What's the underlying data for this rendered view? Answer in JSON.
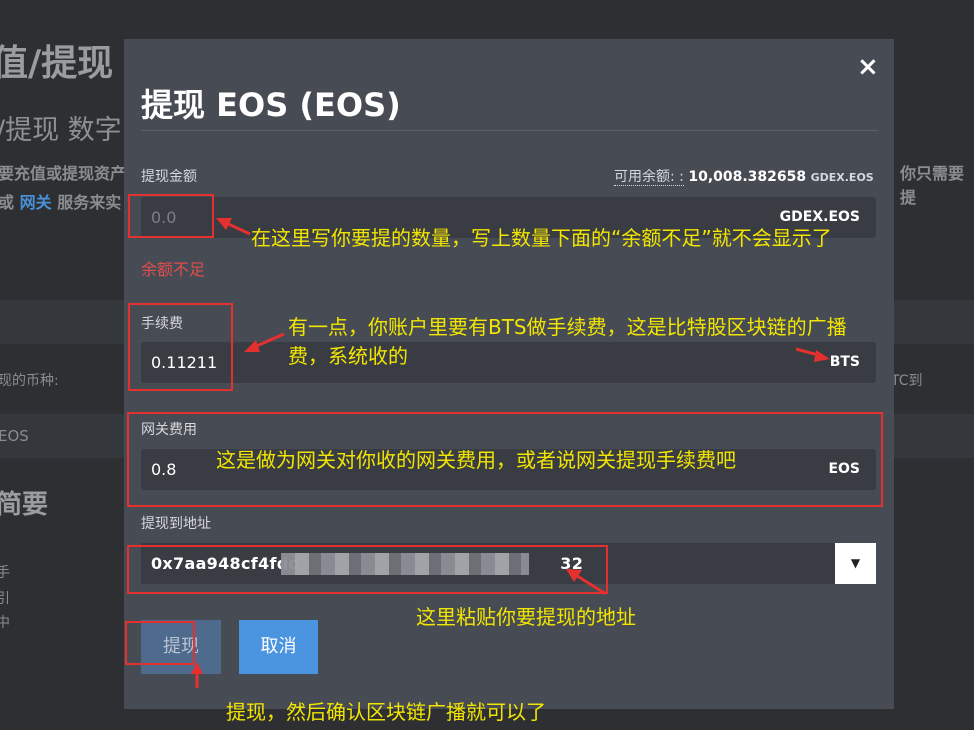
{
  "background": {
    "title": "值/提现",
    "subtitle": "/提现 数字",
    "text1": "要充值或提现资产",
    "text2_prefix": "或",
    "text2_link": "网关",
    "text2_suffix": "服务来实",
    "text_right": "你只需要提",
    "label_coin": "现的币种:",
    "right_note": "TC到",
    "row_eos": "EOS",
    "heading": "简要",
    "small1": "手",
    "small2": "引",
    "small3": "中"
  },
  "modal": {
    "close": "×",
    "title": "提现 EOS (EOS)",
    "amount": {
      "label": "提现金额",
      "available_label": "可用余额: :",
      "available_value": "10,008.382658",
      "available_unit": "GDEX.EOS",
      "placeholder": "0.0",
      "unit": "GDEX.EOS",
      "error": "余额不足"
    },
    "fee": {
      "label": "手续费",
      "value": "0.11211",
      "unit": "BTS"
    },
    "gateway_fee": {
      "label": "网关费用",
      "value": "0.8",
      "unit": "EOS"
    },
    "address": {
      "label": "提现到地址",
      "value_start": "0x7aa948cf4fdc",
      "value_end": "32",
      "dropdown": "▼"
    },
    "buttons": {
      "withdraw": "提现",
      "cancel": "取消"
    }
  },
  "annotations": {
    "amount_note": "在这里写你要提的数量，写上数量下面的“余额不足”就不会显示了",
    "fee_note_line1": "有一点，你账户里要有BTS做手续费，这是比特股区块链的广播",
    "fee_note_line2": "费，系统收的",
    "gateway_note": "这是做为网关对你收的网关费用，或者说网关提现手续费吧",
    "address_note": "这里粘贴你要提现的地址",
    "withdraw_note": "提现，然后确认区块链广播就可以了"
  },
  "colors": {
    "modal_bg": "#474b53",
    "field_bg": "#393c42",
    "error": "#e24d4d",
    "cancel_button": "#4a94e0",
    "annotation_text": "#f2e600",
    "annotation_box": "#e53030"
  }
}
